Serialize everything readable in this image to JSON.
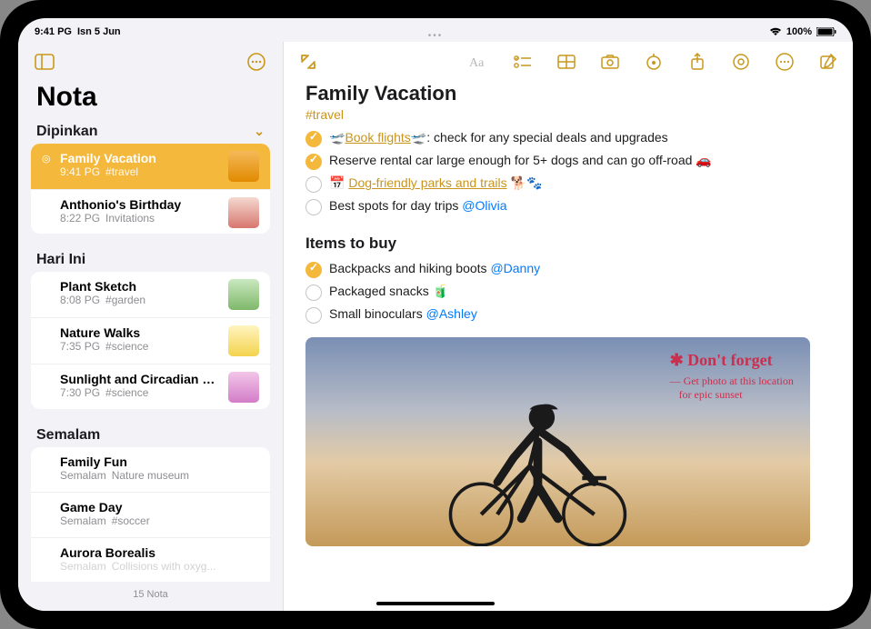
{
  "status": {
    "time": "9:41 PG",
    "date": "Isn 5 Jun",
    "battery": "100%"
  },
  "sidebar": {
    "title": "Nota",
    "footer": "15 Nota",
    "sections": [
      {
        "header": "Dipinkan",
        "items": [
          {
            "title": "Family Vacation",
            "time": "9:41 PG",
            "tag": "#travel",
            "selected": true,
            "pinned": true
          },
          {
            "title": "Anthonio's Birthday",
            "time": "8:22 PG",
            "tag": "Invitations"
          }
        ]
      },
      {
        "header": "Hari Ini",
        "items": [
          {
            "title": "Plant Sketch",
            "time": "8:08 PG",
            "tag": "#garden"
          },
          {
            "title": "Nature Walks",
            "time": "7:35 PG",
            "tag": "#science"
          },
          {
            "title": "Sunlight and Circadian Rhy...",
            "time": "7:30 PG",
            "tag": "#science"
          }
        ]
      },
      {
        "header": "Semalam",
        "items": [
          {
            "title": "Family Fun",
            "time": "Semalam",
            "tag": "Nature museum"
          },
          {
            "title": "Game Day",
            "time": "Semalam",
            "tag": "#soccer"
          },
          {
            "title": "Aurora Borealis",
            "time": "Semalam",
            "tag": "Collisions with oxyg..."
          }
        ]
      }
    ]
  },
  "note": {
    "title": "Family Vacation",
    "tag": "#travel",
    "items": [
      {
        "checked": true,
        "prefix": "🛫",
        "link": "Book flights",
        "linkSuffix": "🛫",
        "rest": ": check for any special deals and upgrades"
      },
      {
        "checked": true,
        "text": "Reserve rental car large enough for 5+ dogs and can go off-road 🚗"
      },
      {
        "checked": false,
        "iconPrefix": "📅",
        "link": "Dog-friendly parks and trails",
        "linkSuffix": " 🐕🐾"
      },
      {
        "checked": false,
        "text": "Best spots for day trips ",
        "mention": "@Olivia"
      }
    ],
    "subheading": "Items to buy",
    "items2": [
      {
        "checked": true,
        "text": "Backpacks and hiking boots ",
        "mention": "@Danny"
      },
      {
        "checked": false,
        "text": "Packaged snacks 🧃"
      },
      {
        "checked": false,
        "text": "Small binoculars ",
        "mention": "@Ashley"
      }
    ],
    "handwriting": {
      "main": "Don't forget",
      "sub1": "— Get photo at this location",
      "sub2": "for epic sunset"
    }
  }
}
